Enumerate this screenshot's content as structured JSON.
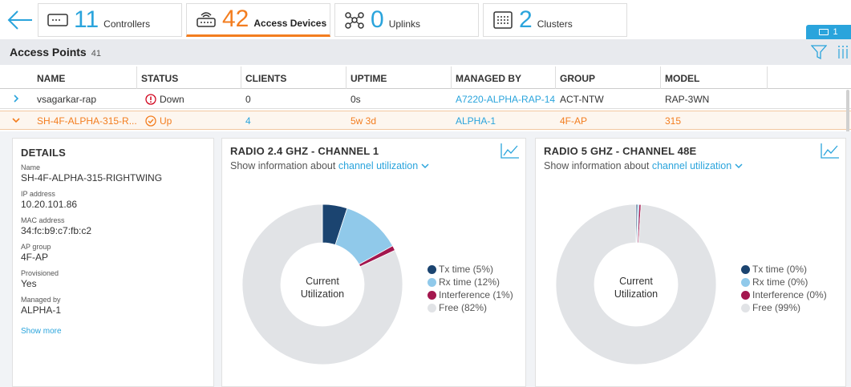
{
  "tabs": [
    {
      "count": "11",
      "label": "Controllers"
    },
    {
      "count": "42",
      "label": "Access Devices"
    },
    {
      "count": "0",
      "label": "Uplinks"
    },
    {
      "count": "2",
      "label": "Clusters"
    }
  ],
  "badge": {
    "count": "1"
  },
  "section": {
    "title": "Access Points",
    "count": "41"
  },
  "table": {
    "headers": [
      "NAME",
      "STATUS",
      "CLIENTS",
      "UPTIME",
      "MANAGED BY",
      "GROUP",
      "MODEL"
    ],
    "rows": [
      {
        "name": "vsagarkar-rap",
        "status": "Down",
        "clients": "0",
        "uptime": "0s",
        "managed_by": "A7220-ALPHA-RAP-14",
        "group": "ACT-NTW",
        "model": "RAP-3WN"
      },
      {
        "name": "SH-4F-ALPHA-315-R...",
        "status": "Up",
        "clients": "4",
        "uptime": "5w 3d",
        "managed_by": "ALPHA-1",
        "group": "4F-AP",
        "model": "315"
      }
    ]
  },
  "details": {
    "title": "DETAILS",
    "fields": [
      {
        "label": "Name",
        "value": "SH-4F-ALPHA-315-RIGHTWING"
      },
      {
        "label": "IP address",
        "value": "10.20.101.86"
      },
      {
        "label": "MAC address",
        "value": "34:fc:b9:c7:fb:c2"
      },
      {
        "label": "AP group",
        "value": "4F-AP"
      },
      {
        "label": "Provisioned",
        "value": "Yes"
      },
      {
        "label": "Managed by",
        "value": "ALPHA-1"
      }
    ],
    "show_more": "Show more"
  },
  "radios": [
    {
      "title": "RADIO 2.4 GHZ - CHANNEL 1",
      "sub_prefix": "Show information about",
      "sub_link": "channel utilization",
      "center_line1": "Current",
      "center_line2": "Utilization",
      "legend": [
        "Tx time (5%)",
        "Rx time (12%)",
        "Interference (1%)",
        "Free (82%)"
      ]
    },
    {
      "title": "RADIO 5 GHZ - CHANNEL 48E",
      "sub_prefix": "Show information about",
      "sub_link": "channel utilization",
      "center_line1": "Current",
      "center_line2": "Utilization",
      "legend": [
        "Tx time (0%)",
        "Rx time (0%)",
        "Interference (0%)",
        "Free (99%)"
      ]
    }
  ],
  "chart_data": [
    {
      "type": "pie",
      "title": "RADIO 2.4 GHZ - CHANNEL 1",
      "categories": [
        "Tx time",
        "Rx time",
        "Interference",
        "Free"
      ],
      "values": [
        5,
        12,
        1,
        82
      ],
      "colors": [
        "#1b4470",
        "#90c9ea",
        "#a3174e",
        "#e1e3e6"
      ]
    },
    {
      "type": "pie",
      "title": "RADIO 5 GHZ - CHANNEL 48E",
      "categories": [
        "Tx time",
        "Rx time",
        "Interference",
        "Free"
      ],
      "values": [
        0.3,
        0.3,
        0.4,
        99
      ],
      "colors": [
        "#1b4470",
        "#90c9ea",
        "#a3174e",
        "#e1e3e6"
      ]
    }
  ],
  "colors": {
    "accent": "#2aa4dc",
    "active": "#f37d1f",
    "error": "#d0021b"
  }
}
